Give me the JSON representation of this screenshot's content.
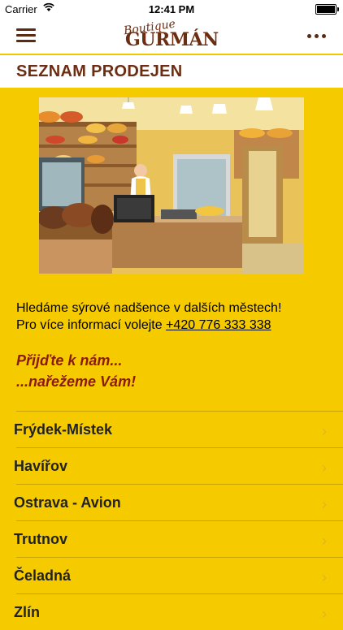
{
  "status_bar": {
    "carrier": "Carrier",
    "time": "12:41 PM"
  },
  "navbar": {
    "logo_small": "Boutique",
    "logo_big": "GURMÁN"
  },
  "section": {
    "title": "SEZNAM PRODEJEN"
  },
  "info": {
    "line1": "Hledáme sýrové nadšence v dalších městech!",
    "line2_prefix": "Pro více informací volejte ",
    "phone": "+420 776 333 338"
  },
  "slogan": {
    "line1": "Přijďte k nám...",
    "line2": "...nařežeme Vám!"
  },
  "stores": [
    {
      "label": "Frýdek-Místek"
    },
    {
      "label": "Havířov"
    },
    {
      "label": "Ostrava - Avion"
    },
    {
      "label": "Trutnov"
    },
    {
      "label": "Čeladná"
    },
    {
      "label": "Zlín"
    }
  ],
  "colors": {
    "background": "#f5cb00",
    "brand_brown": "#6b2e12",
    "slogan_red": "#8b1a0e"
  }
}
